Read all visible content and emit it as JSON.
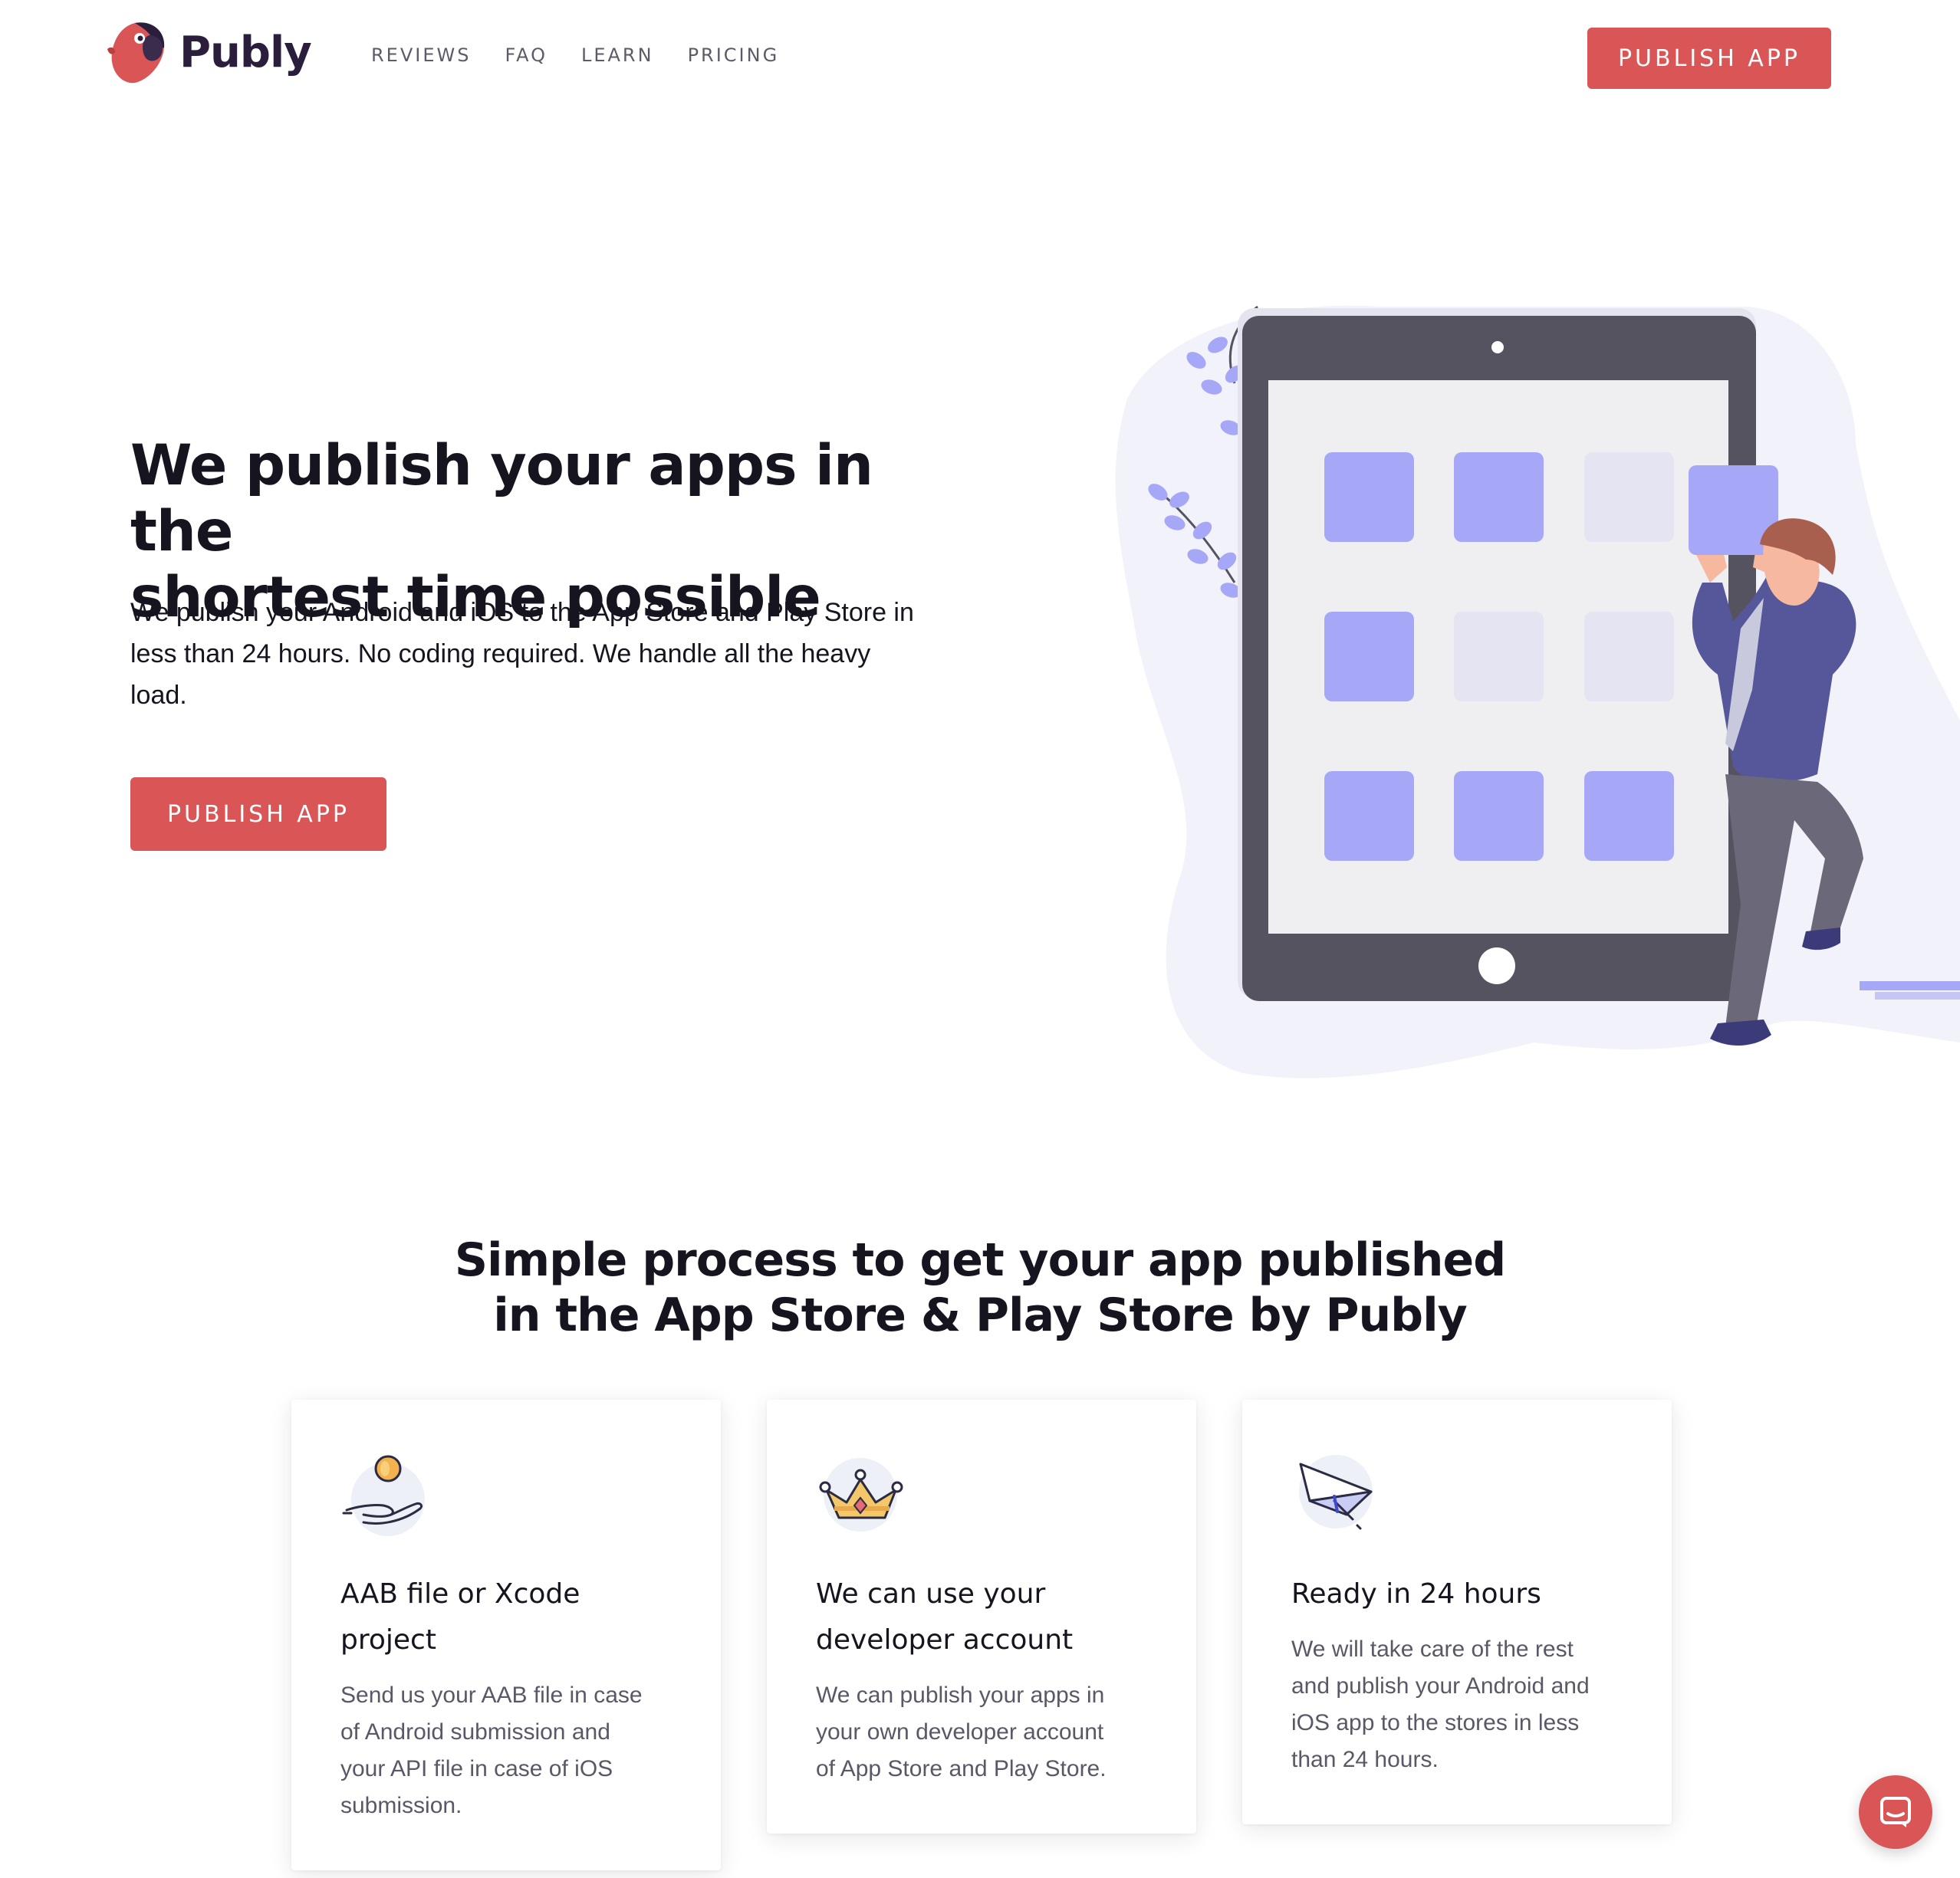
{
  "header": {
    "brand": "Publy",
    "nav": [
      {
        "label": "REVIEWS"
      },
      {
        "label": "FAQ"
      },
      {
        "label": "LEARN"
      },
      {
        "label": "PRICING"
      }
    ],
    "cta_label": "PUBLISH APP"
  },
  "hero": {
    "title_line1": "We publish your apps in the",
    "title_line2": "shortest time possible",
    "desc_line1": "We publish your Android and iOS to the App Store and Play Store in",
    "desc_line2": "less than 24 hours. No coding required. We handle all the heavy",
    "desc_line3": "load.",
    "cta_label": "PUBLISH APP"
  },
  "process": {
    "title_line1": "Simple process to get your app published",
    "title_line2": "in the App Store & Play Store by Publy",
    "cards": [
      {
        "icon": "coin-hand-icon",
        "title_line1": "AAB file or Xcode",
        "title_line2": "project",
        "text_lines": [
          "Send us your AAB file in case",
          "of Android submission and",
          "your API file in case of iOS",
          "submission."
        ]
      },
      {
        "icon": "crown-icon",
        "title_line1": "We can use your",
        "title_line2": "developer account",
        "text_lines": [
          "We can publish your apps in",
          "your own developer account",
          "of App Store and Play Store."
        ]
      },
      {
        "icon": "paper-plane-icon",
        "title_line1": "Ready in 24 hours",
        "title_line2": "",
        "text_lines": [
          "We will take care of the rest",
          "and publish your Android and",
          "iOS app to the stores in less",
          "than 24 hours."
        ]
      }
    ]
  },
  "colors": {
    "accent": "#d95556",
    "heading": "#16141f",
    "tablet": "#55535f",
    "tile": "#a7a7f8",
    "tile_light": "#e4e4f2",
    "blob": "#f2f2fb"
  }
}
